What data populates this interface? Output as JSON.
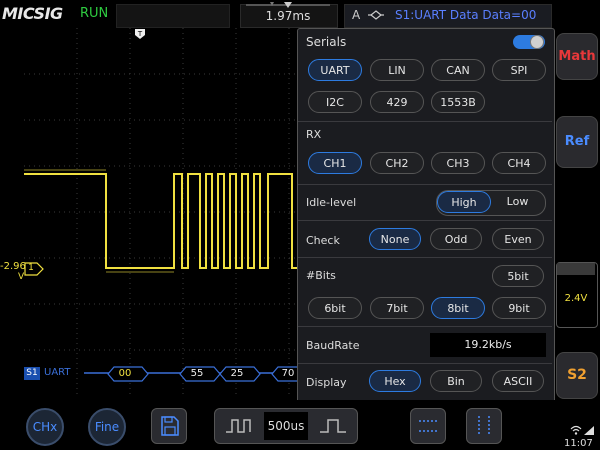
{
  "header": {
    "brand": "MICSIG",
    "run_state": "RUN",
    "timebase": "1.97ms",
    "trigger_mode": "A",
    "trigger_source": "S1:UART Data Data=00"
  },
  "waveform": {
    "channel_marker": "1",
    "offset_value": "-2.96",
    "offset_unit": "V",
    "decode_bus_label": "S1",
    "decode_protocol": "UART",
    "decoded_bytes": [
      "00",
      "55",
      "25",
      "70"
    ]
  },
  "panel": {
    "serials_label": "Serials",
    "serials_enabled": true,
    "protocols": [
      {
        "label": "UART",
        "selected": true
      },
      {
        "label": "LIN",
        "selected": false
      },
      {
        "label": "CAN",
        "selected": false
      },
      {
        "label": "SPI",
        "selected": false
      },
      {
        "label": "I2C",
        "selected": false
      },
      {
        "label": "429",
        "selected": false
      },
      {
        "label": "1553B",
        "selected": false
      }
    ],
    "rx_label": "RX",
    "rx_channels": [
      {
        "label": "CH1",
        "selected": true
      },
      {
        "label": "CH2",
        "selected": false
      },
      {
        "label": "CH3",
        "selected": false
      },
      {
        "label": "CH4",
        "selected": false
      }
    ],
    "idle_label": "Idle-level",
    "idle_options": [
      {
        "label": "High",
        "selected": true
      },
      {
        "label": "Low",
        "selected": false
      }
    ],
    "check_label": "Check",
    "check_options": [
      {
        "label": "None",
        "selected": true
      },
      {
        "label": "Odd",
        "selected": false
      },
      {
        "label": "Even",
        "selected": false
      }
    ],
    "bits_label": "#Bits",
    "bits_options": [
      {
        "label": "5bit",
        "selected": false
      },
      {
        "label": "6bit",
        "selected": false
      },
      {
        "label": "7bit",
        "selected": false
      },
      {
        "label": "8bit",
        "selected": true
      },
      {
        "label": "9bit",
        "selected": false
      }
    ],
    "baud_label": "BaudRate",
    "baud_value": "19.2kb/s",
    "display_label": "Display",
    "display_options": [
      {
        "label": "Hex",
        "selected": true
      },
      {
        "label": "Bin",
        "selected": false
      },
      {
        "label": "ASCII",
        "selected": false
      }
    ]
  },
  "side": {
    "math_label": "Math",
    "ref_label": "Ref",
    "channel_scale": "2.4V",
    "s2_label": "S2"
  },
  "bottom": {
    "chx_label": "CHx",
    "fine_label": "Fine",
    "timebase_value": "500us",
    "clock": "11:07"
  },
  "colors": {
    "trace": "#f0e040",
    "accent": "#2d7be0",
    "math": "#e8383a",
    "ref": "#4a8cff",
    "s2": "#f0a030",
    "run": "#2ecc40"
  }
}
